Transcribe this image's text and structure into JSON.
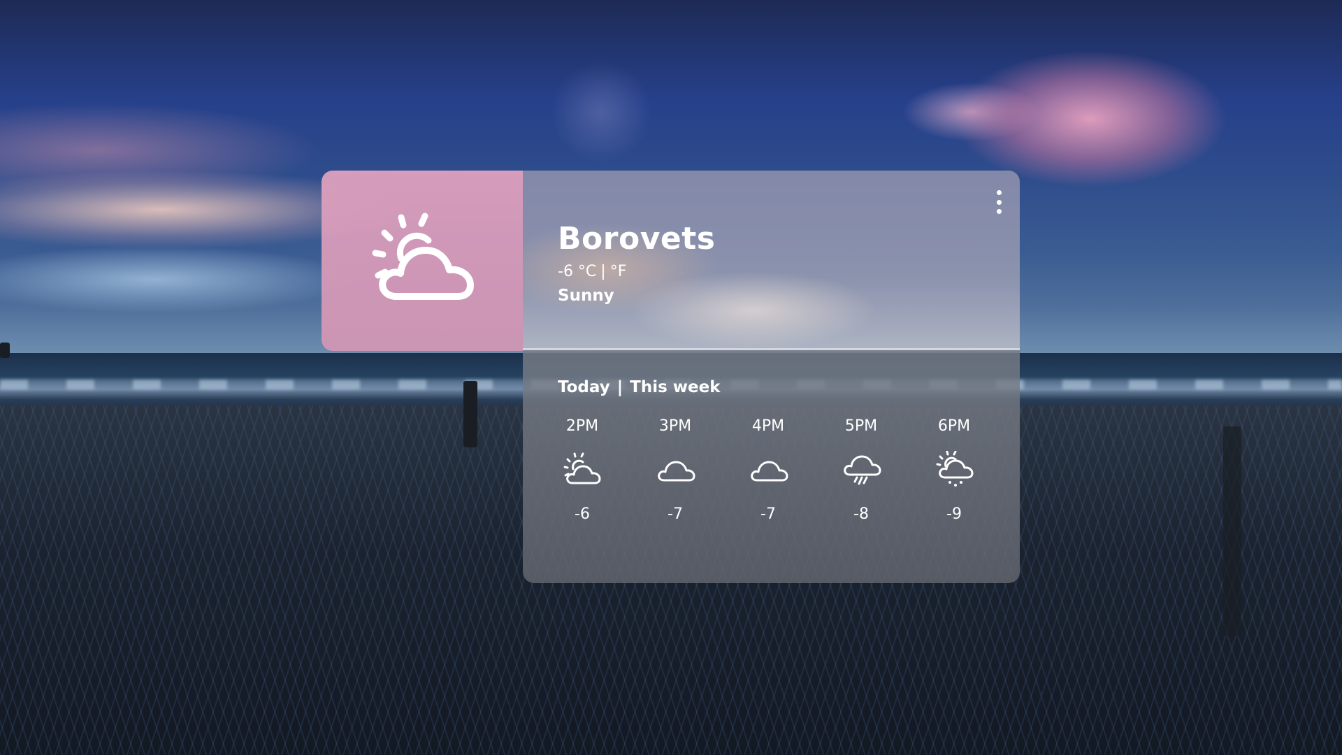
{
  "weather": {
    "city": "Borovets",
    "temp_celsius": "-6 °C",
    "separator": "|",
    "temp_fahrenheit": "°F",
    "condition": "Sunny",
    "main_icon": "partly-sunny-cloud-icon",
    "menu_icon": "more-vertical-icon"
  },
  "tabs": {
    "today": "Today",
    "separator": "|",
    "this_week": "This week"
  },
  "forecast": [
    {
      "time": "2PM",
      "icon": "partly-sunny-cloud-icon",
      "temp": "-6"
    },
    {
      "time": "3PM",
      "icon": "cloud-icon",
      "temp": "-7"
    },
    {
      "time": "4PM",
      "icon": "cloud-icon",
      "temp": "-7"
    },
    {
      "time": "5PM",
      "icon": "rain-cloud-icon",
      "temp": "-8"
    },
    {
      "time": "6PM",
      "icon": "sun-cloud-snow-icon",
      "temp": "-9"
    }
  ],
  "colors": {
    "icon_panel": "#dea0be",
    "text": "#ffffff"
  }
}
